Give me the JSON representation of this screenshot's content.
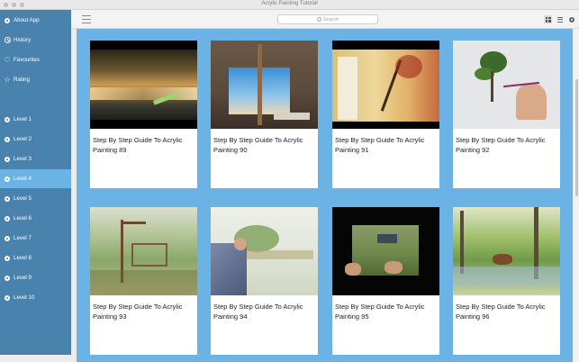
{
  "window": {
    "title": "Acrylic Painting Tutorial"
  },
  "search": {
    "placeholder": "Search"
  },
  "sidebar": {
    "items": [
      {
        "label": "About App",
        "icon": "info-icon",
        "active": false
      },
      {
        "label": "History",
        "icon": "clock-icon",
        "active": false
      },
      {
        "label": "Favourites",
        "icon": "heart-icon",
        "active": false
      },
      {
        "label": "Rating",
        "icon": "star-icon",
        "active": false
      },
      {
        "label": "Level 1",
        "icon": "level-dot-icon",
        "active": false
      },
      {
        "label": "Level 2",
        "icon": "level-dot-icon",
        "active": false
      },
      {
        "label": "Level 3",
        "icon": "level-dot-icon",
        "active": false
      },
      {
        "label": "Level 4",
        "icon": "level-dot-icon",
        "active": true
      },
      {
        "label": "Level 5",
        "icon": "level-dot-icon",
        "active": false
      },
      {
        "label": "Level 6",
        "icon": "level-dot-icon",
        "active": false
      },
      {
        "label": "Level 7",
        "icon": "level-dot-icon",
        "active": false
      },
      {
        "label": "Level 8",
        "icon": "level-dot-icon",
        "active": false
      },
      {
        "label": "Level 9",
        "icon": "level-dot-icon",
        "active": false
      },
      {
        "label": "Level 10",
        "icon": "level-dot-icon",
        "active": false
      }
    ]
  },
  "cards": [
    {
      "title": "Step By Step Guide To Acrylic Painting 89",
      "rating": "☆☆☆☆☆☆☆☆☆☆",
      "thumb": "sunset-sea"
    },
    {
      "title": "Step By Step Guide To Acrylic Painting 90",
      "rating": "☆☆☆☆☆☆☆☆☆☆",
      "thumb": "easel-sky"
    },
    {
      "title": "Step By Step Guide To Acrylic Painting 91",
      "rating": "☆☆☆☆☆☆☆☆☆☆",
      "thumb": "tree-canvas"
    },
    {
      "title": "Step By Step Guide To Acrylic Painting 92",
      "rating": "☆☆☆☆☆☆☆☆☆☆",
      "thumb": "bonsai-tree"
    },
    {
      "title": "Step By Step Guide To Acrylic Painting 93",
      "rating": "☆☆☆☆☆☆☆☆☆☆",
      "thumb": "gate-landscape"
    },
    {
      "title": "Step By Step Guide To Acrylic Painting 94",
      "rating": "☆☆☆☆☆☆☆☆☆☆",
      "thumb": "watercolor-field"
    },
    {
      "title": "Step By Step Guide To Acrylic Painting 95",
      "rating": "☆☆☆☆☆☆☆☆☆☆",
      "thumb": "cart-meadow"
    },
    {
      "title": "Step By Step Guide To Acrylic Painting 96",
      "rating": "☆☆☆☆☆☆☆☆☆☆",
      "thumb": "horse-forest"
    }
  ],
  "colors": {
    "sidebar": "#4982ad",
    "active": "#6bb2e5",
    "content": "#6bb2e5"
  }
}
